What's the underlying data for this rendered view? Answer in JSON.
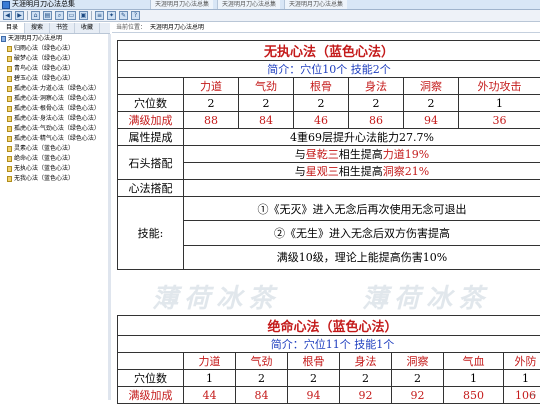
{
  "window": {
    "title": "天涯明月刀心法总集",
    "tabs": [
      "天涯明月刀心法总集",
      "天涯明月刀心法总集",
      "天涯明月刀心法总集"
    ]
  },
  "toolbar": {
    "buttons": [
      "back-icon",
      "forward-icon",
      "home-icon",
      "print-icon",
      "find-icon",
      "folder-icon",
      "save-icon",
      "options-icon",
      "bookmark-icon",
      "edit-icon",
      "help-icon"
    ]
  },
  "sidebar": {
    "tabs": [
      "目录",
      "搜索",
      "书签",
      "收藏"
    ],
    "items": [
      {
        "label": "天涯明月刀心法总明",
        "root": true
      },
      {
        "label": "归雨心法（绿色心法）"
      },
      {
        "label": "破梦心法（绿色心法）"
      },
      {
        "label": "青鸟心法（绿色心法）"
      },
      {
        "label": "碧玉心法（绿色心法）"
      },
      {
        "label": "孤虎心法·力道心法（绿色心法）"
      },
      {
        "label": "孤虎心法·洞察心法（绿色心法）"
      },
      {
        "label": "孤虎心法·根骨心法（绿色心法）"
      },
      {
        "label": "孤虎心法·身法心法（绿色心法）"
      },
      {
        "label": "孤虎心法·气劲心法（绿色心法）"
      },
      {
        "label": "孤虎心法·精气心法（绿色心法）"
      },
      {
        "label": "灵素心法（蓝色心法）"
      },
      {
        "label": "绝命心法（蓝色心法）"
      },
      {
        "label": "无执心法（蓝色心法）"
      },
      {
        "label": "无我心法（蓝色心法）"
      }
    ]
  },
  "address": {
    "label": "当前位置：",
    "value": "天涯明月刀心法总明"
  },
  "card1": {
    "title": "无执心法（蓝色心法）",
    "intro_prefix": "简介：穴位10个 ",
    "intro_skill": "技能2个",
    "headers": [
      "力道",
      "气劲",
      "根骨",
      "身法",
      "洞察",
      "外功攻击"
    ],
    "row_points_label": "穴位数",
    "row_points": [
      "2",
      "2",
      "2",
      "2",
      "2",
      "1"
    ],
    "row_max_label": "满级加成",
    "row_max": [
      "88",
      "84",
      "46",
      "86",
      "94",
      "36"
    ],
    "attr_label": "属性提成",
    "attr_value": "4重69层提升心法能力27.7%",
    "stone_label": "石头搭配",
    "stone1_a": "与",
    "stone1_b": "昼乾三",
    "stone1_c": "相生提高",
    "stone1_d": "力道19%",
    "stone2_a": "与",
    "stone2_b": "星观三",
    "stone2_c": "相生提高",
    "stone2_d": "洞察21%",
    "combo_label": "心法搭配",
    "combo_value": "",
    "skill_label": "技能:",
    "skill1": "①《无灭》进入无念后再次使用无念可退出",
    "skill2": "②《无生》进入无念后双方伤害提高",
    "skill3": "满级10级，理论上能提高伤害10%"
  },
  "card2": {
    "title": "绝命心法（蓝色心法）",
    "intro_prefix": "简介：穴位11个 ",
    "intro_skill": "技能1个",
    "headers": [
      "力道",
      "气劲",
      "根骨",
      "身法",
      "洞察",
      "气血",
      "外防"
    ],
    "row_points_label": "穴位数",
    "row_points": [
      "1",
      "2",
      "2",
      "2",
      "2",
      "1",
      "1"
    ],
    "row_max_label": "满级加成",
    "row_max": [
      "44",
      "84",
      "94",
      "92",
      "92",
      "850",
      "106"
    ]
  },
  "watermark": {
    "text": "薄荷冰茶"
  },
  "corner_watermark": "",
  "colors": {
    "red": "#c41b1b",
    "blue": "#1f3fbf"
  }
}
